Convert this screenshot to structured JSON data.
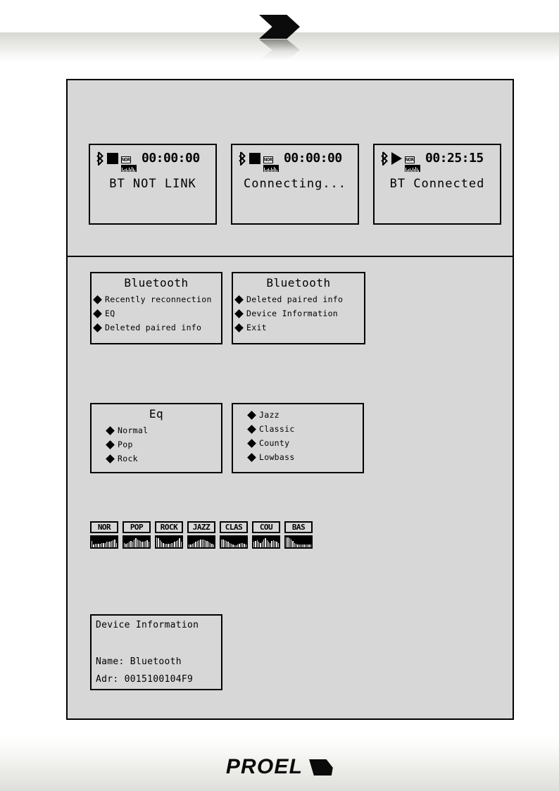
{
  "brand": {
    "name": "PROEL",
    "mark": "chevron-mark"
  },
  "header": {
    "arrow": "double-chevron-arrow"
  },
  "lcd_panels": [
    {
      "id": "bt-not-link",
      "bluetooth_icon": "bluetooth-icon",
      "transport_icon": "stop-icon",
      "eq_badge": "NOR",
      "time": "00:00:00",
      "message": "BT NOT LINK"
    },
    {
      "id": "connecting",
      "bluetooth_icon": "bluetooth-icon",
      "transport_icon": "stop-icon",
      "eq_badge": "NOR",
      "time": "00:00:00",
      "message": "Connecting..."
    },
    {
      "id": "bt-connected",
      "bluetooth_icon": "bluetooth-icon",
      "transport_icon": "play-icon",
      "eq_badge": "NOR",
      "time": "00:25:15",
      "message": "BT Connected"
    }
  ],
  "menus": [
    {
      "id": "bluetooth-menu-1",
      "title": "Bluetooth",
      "items": [
        "Recently reconnection",
        "EQ",
        "Deleted paired info"
      ]
    },
    {
      "id": "bluetooth-menu-2",
      "title": "Bluetooth",
      "items": [
        "Deleted paired info",
        "Device Information",
        "Exit"
      ]
    },
    {
      "id": "eq-menu-1",
      "title": "Eq",
      "items": [
        "Normal",
        "Pop",
        "Rock"
      ]
    },
    {
      "id": "eq-menu-2",
      "title": "",
      "items": [
        "Jazz",
        "Classic",
        "County",
        "Lowbass"
      ]
    }
  ],
  "eq_presets": [
    {
      "label": "NOR",
      "bars": [
        7,
        3,
        4,
        4,
        4,
        4,
        5,
        5,
        5,
        6,
        6,
        6,
        7,
        8,
        9,
        5
      ]
    },
    {
      "label": "POP",
      "bars": [
        5,
        4,
        5,
        6,
        7,
        6,
        9,
        10,
        9,
        8,
        7,
        6,
        6,
        7,
        8,
        6
      ]
    },
    {
      "label": "ROCK",
      "bars": [
        11,
        10,
        8,
        6,
        5,
        4,
        4,
        4,
        4,
        5,
        5,
        6,
        7,
        8,
        10,
        6
      ]
    },
    {
      "label": "JAZZ",
      "bars": [
        3,
        3,
        4,
        5,
        6,
        7,
        8,
        9,
        9,
        9,
        8,
        7,
        6,
        5,
        4,
        3
      ]
    },
    {
      "label": "CLAS",
      "bars": [
        9,
        9,
        8,
        7,
        6,
        5,
        4,
        3,
        2,
        2,
        3,
        4,
        5,
        5,
        4,
        3
      ]
    },
    {
      "label": "COU",
      "bars": [
        6,
        7,
        8,
        6,
        5,
        6,
        9,
        10,
        8,
        6,
        5,
        7,
        8,
        7,
        6,
        5
      ]
    },
    {
      "label": "BAS",
      "bars": [
        11,
        11,
        10,
        9,
        7,
        5,
        4,
        3,
        3,
        3,
        3,
        3,
        3,
        3,
        3,
        3
      ]
    }
  ],
  "device_info": {
    "title": "Device Information",
    "name_line": "Name: Bluetooth",
    "addr_line": "Adr: 0015100104F9"
  }
}
